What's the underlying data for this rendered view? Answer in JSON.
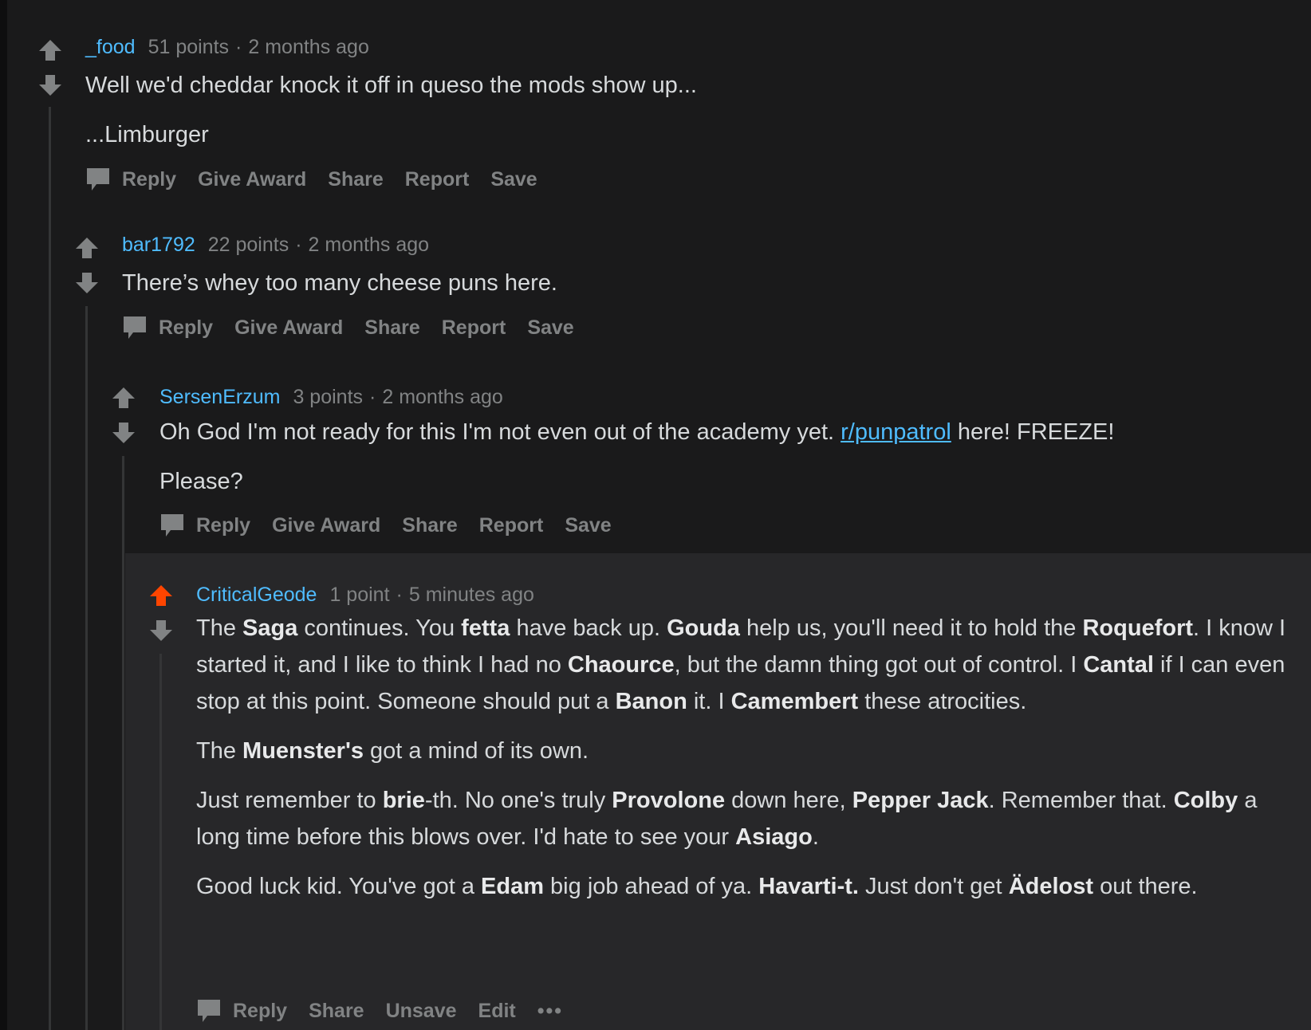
{
  "comments": [
    {
      "author": "_food",
      "points": "51 points",
      "separator": "·",
      "time": "2 months ago",
      "paragraphs": [
        "Well we'd cheddar knock it off in queso the mods show up...",
        "...Limburger"
      ],
      "actions": [
        "Reply",
        "Give Award",
        "Share",
        "Report",
        "Save"
      ]
    },
    {
      "author": "bar1792",
      "points": "22 points",
      "separator": "·",
      "time": "2 months ago",
      "paragraphs": [
        "There’s whey too many cheese puns here."
      ],
      "actions": [
        "Reply",
        "Give Award",
        "Share",
        "Report",
        "Save"
      ]
    },
    {
      "author": "SersenErzum",
      "points": "3 points",
      "separator": "·",
      "time": "2 months ago",
      "paragraph1_pre": "Oh God I'm not ready for this I'm not even out of the academy yet. ",
      "link": "r/punpatrol",
      "paragraph1_post": " here! FREEZE!",
      "paragraph2": "Please?",
      "actions": [
        "Reply",
        "Give Award",
        "Share",
        "Report",
        "Save"
      ]
    },
    {
      "author": "CriticalGeode",
      "points": "1 point",
      "separator": "·",
      "time": "5 minutes ago",
      "upvoted": true,
      "p1": {
        "t1": "The ",
        "b1": "Saga",
        "t2": " continues. You ",
        "b2": "fetta",
        "t3": " have back up. ",
        "b3": "Gouda",
        "t4": " help us, you'll need it to hold the ",
        "b4": "Roquefort",
        "t5": ". I know I started it, and I like to think I had no ",
        "b5": "Chaource",
        "t6": ", but the damn thing got out of control. I ",
        "b6": "Cantal",
        "t7": " if I can even stop at this point. Someone should put a ",
        "b7": "Banon",
        "t8": " it. I ",
        "b8": "Camembert",
        "t9": " these atrocities."
      },
      "p2": {
        "t1": "The ",
        "b1": "Muenster's",
        "t2": " got a mind of its own."
      },
      "p3": {
        "t1": "Just remember to ",
        "b1": "brie",
        "t2": "-th. No one's truly ",
        "b2": "Provolone",
        "t3": " down here, ",
        "b3": "Pepper Jack",
        "t4": ". Remember that. ",
        "b4": "Colby",
        "t5": " a long time before this blows over. I'd hate to see your ",
        "b5": "Asiago",
        "t6": "."
      },
      "p4": {
        "t1": "Good luck kid. You've got a ",
        "b1": "Edam",
        "t2": " big job ahead of ya. ",
        "b2": "Havarti-t.",
        "t3": " Just don't get ",
        "b3": "Ädelost",
        "t4": " out there."
      },
      "actions": [
        "Reply",
        "Share",
        "Unsave",
        "Edit"
      ],
      "more": "•••"
    }
  ],
  "icons": {
    "upvote": "arrow-up-icon",
    "downvote": "arrow-down-icon",
    "reply": "comment-bubble-icon",
    "more": "ellipsis-icon"
  },
  "colors": {
    "background": "#1a1a1b",
    "highlight": "#272729",
    "author": "#4fbcff",
    "muted": "#818384",
    "text": "#d7dadc",
    "upvote_active": "#ff4500"
  }
}
